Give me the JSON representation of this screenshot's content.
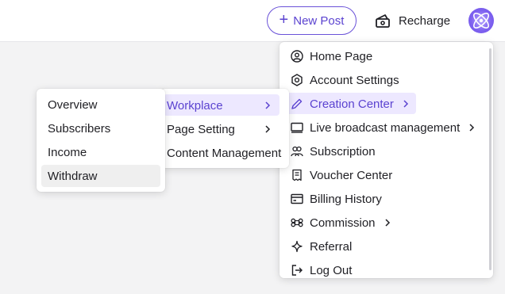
{
  "header": {
    "new_post_label": "New Post",
    "recharge_label": "Recharge",
    "accent": "#5b43d0"
  },
  "account_menu": {
    "items": [
      {
        "label": "Home Page",
        "icon": "user-circle-icon"
      },
      {
        "label": "Account Settings",
        "icon": "hexagon-settings-icon"
      },
      {
        "label": "Creation Center",
        "icon": "pencil-icon",
        "submenu": true,
        "active": true
      },
      {
        "label": "Live broadcast management",
        "icon": "monitor-icon",
        "submenu": true
      },
      {
        "label": "Subscription",
        "icon": "users-icon"
      },
      {
        "label": "Voucher Center",
        "icon": "receipt-icon"
      },
      {
        "label": "Billing History",
        "icon": "card-icon"
      },
      {
        "label": "Commission",
        "icon": "command-icon",
        "submenu": true
      },
      {
        "label": "Referral",
        "icon": "sparkle-icon"
      },
      {
        "label": "Log Out",
        "icon": "logout-icon"
      }
    ]
  },
  "creation_submenu": {
    "items": [
      {
        "label": "Workplace",
        "submenu": true,
        "active": true
      },
      {
        "label": "Page Setting",
        "submenu": true
      },
      {
        "label": "Content Management"
      }
    ]
  },
  "workplace_submenu": {
    "items": [
      {
        "label": "Overview"
      },
      {
        "label": "Subscribers"
      },
      {
        "label": "Income"
      },
      {
        "label": "Withdraw",
        "hover": true
      }
    ]
  }
}
